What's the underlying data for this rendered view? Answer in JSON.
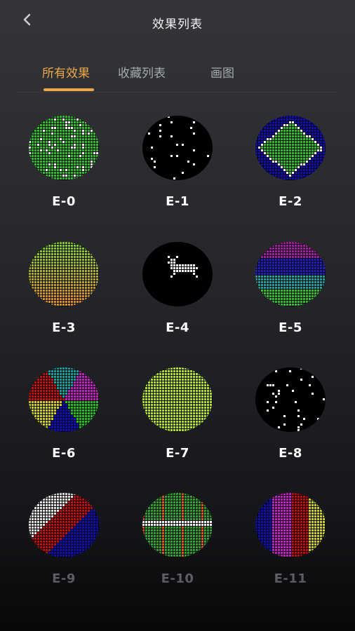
{
  "header": {
    "title": "效果列表",
    "back_icon": "chevron-left-icon"
  },
  "tabs": [
    {
      "label": "所有效果",
      "active": true
    },
    {
      "label": "收藏列表",
      "active": false
    },
    {
      "label": "画图",
      "active": false
    }
  ],
  "colors": {
    "accent": "#eea84a",
    "tab_inactive": "#a7a9ad",
    "label": "#ffffff",
    "label_faded": "#6d6f73"
  },
  "effects": [
    {
      "label": "E-0",
      "pattern": "green-sparkle",
      "colors": [
        "#2fbf2f",
        "#ffffff"
      ]
    },
    {
      "label": "E-1",
      "pattern": "black-sparkle",
      "colors": [
        "#000000",
        "#ffffff"
      ]
    },
    {
      "label": "E-2",
      "pattern": "blue-diamond",
      "colors": [
        "#1010b0",
        "#2fbf2f",
        "#ffffff"
      ]
    },
    {
      "label": "E-3",
      "pattern": "green-orange-gradient",
      "colors": [
        "#7fcf2f",
        "#e08a20"
      ]
    },
    {
      "label": "E-4",
      "pattern": "deer",
      "colors": [
        "#000000",
        "#ffffff"
      ]
    },
    {
      "label": "E-5",
      "pattern": "horizontal-rainbow",
      "colors": [
        "#a020a0",
        "#2020c0",
        "#20a0a0",
        "#30c030"
      ]
    },
    {
      "label": "E-6",
      "pattern": "pie-segments",
      "colors": [
        "#c01010",
        "#10a0a0",
        "#c020c0",
        "#20c020",
        "#1010c0",
        "#d0d020"
      ]
    },
    {
      "label": "E-7",
      "pattern": "solid-lime",
      "colors": [
        "#b0e020"
      ]
    },
    {
      "label": "E-8",
      "pattern": "black-sparkle",
      "colors": [
        "#000000",
        "#ffffff"
      ]
    },
    {
      "label": "E-9",
      "pattern": "diagonal-stripes",
      "colors": [
        "#1010b0",
        "#c01010",
        "#e0e0e0"
      ]
    },
    {
      "label": "E-10",
      "pattern": "green-scanline",
      "colors": [
        "#30a030",
        "#e05a20",
        "#ffffff"
      ]
    },
    {
      "label": "E-11",
      "pattern": "vertical-stripes",
      "colors": [
        "#1010b0",
        "#c020c0",
        "#c01010",
        "#d0d020"
      ]
    }
  ]
}
